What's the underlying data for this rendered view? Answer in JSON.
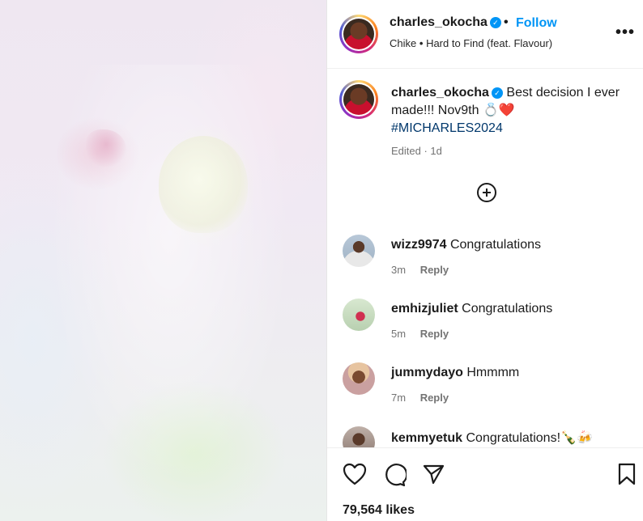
{
  "post": {
    "author": "charles_okocha",
    "verified_mark": "✓",
    "follow_label": "Follow",
    "separator": "•",
    "music": {
      "artist": "Chike",
      "track": "Hard to Find (feat. Flavour)"
    },
    "more_label": "•••"
  },
  "caption": {
    "author": "charles_okocha",
    "text": "Best decision I ever made!!! Nov9th 💍❤️",
    "hashtag": "#MICHARLES2024",
    "edited": "Edited · 1d"
  },
  "comments": [
    {
      "username": "wizz9974",
      "text": "Congratulations",
      "time": "3m",
      "reply_label": "Reply"
    },
    {
      "username": "emhizjuliet",
      "text": "Congratulations",
      "time": "5m",
      "reply_label": "Reply"
    },
    {
      "username": "jummydayo",
      "text": "Hmmmm",
      "time": "7m",
      "reply_label": "Reply"
    },
    {
      "username": "kemmyetuk",
      "text": "Congratulations!🍾🍻",
      "time": "",
      "reply_label": ""
    }
  ],
  "actions": {
    "icons": [
      "heart-icon",
      "comment-icon",
      "share-icon",
      "bookmark-icon"
    ]
  },
  "likes": "79,564 likes",
  "colors": {
    "accent": "#0095f6",
    "hashtag": "#00376b",
    "muted": "#737373"
  }
}
